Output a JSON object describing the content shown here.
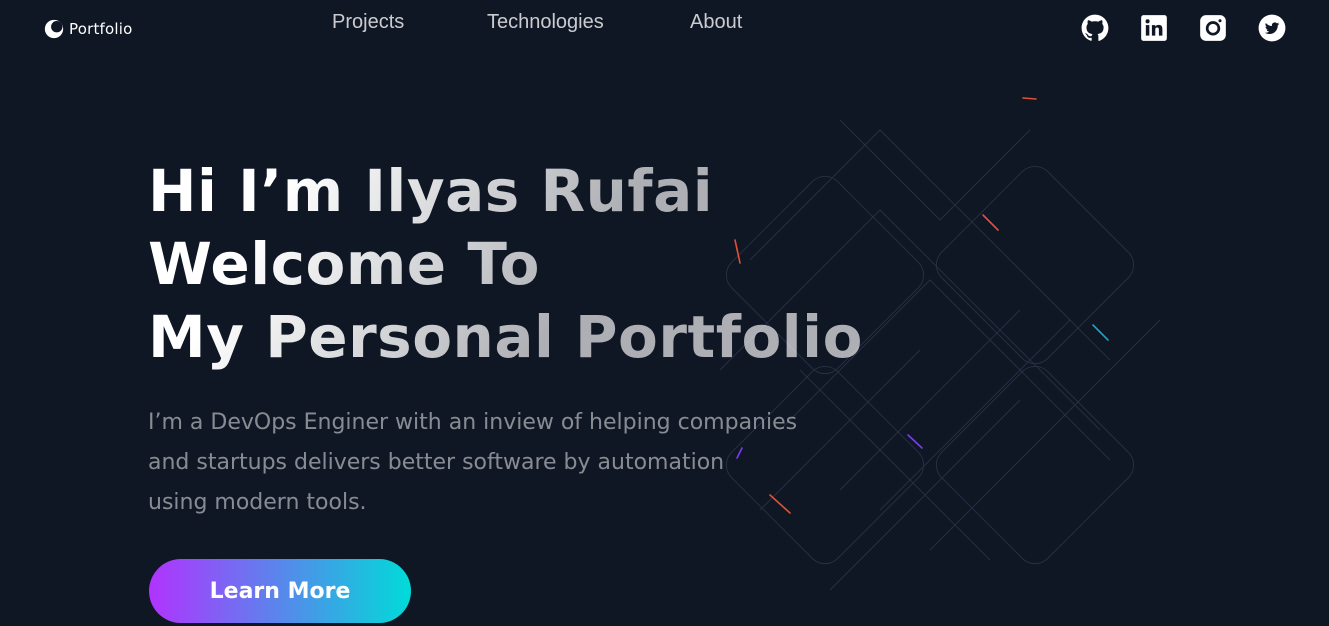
{
  "header": {
    "logo_text": "Portfolio",
    "nav": [
      {
        "label": "Projects"
      },
      {
        "label": "Technologies"
      },
      {
        "label": "About"
      }
    ],
    "socials": [
      {
        "icon": "github-icon"
      },
      {
        "icon": "linkedin-icon"
      },
      {
        "icon": "instagram-icon"
      },
      {
        "icon": "twitter-icon"
      }
    ]
  },
  "hero": {
    "title_lines": [
      "Hi I’m Ilyas Rufai",
      "Welcome To",
      "My Personal Portfolio"
    ],
    "description_lines": [
      "I’m a DevOps Enginer with an inview of helping companies",
      "and startups delivers better software by automation",
      "using modern tools."
    ],
    "cta_label": "Learn More"
  },
  "colors": {
    "background": "#0f1624",
    "cta_gradient_start": "#b133ff",
    "cta_gradient_end": "#00dbd8",
    "text_muted": "rgba(255,255,255,0.5)"
  }
}
